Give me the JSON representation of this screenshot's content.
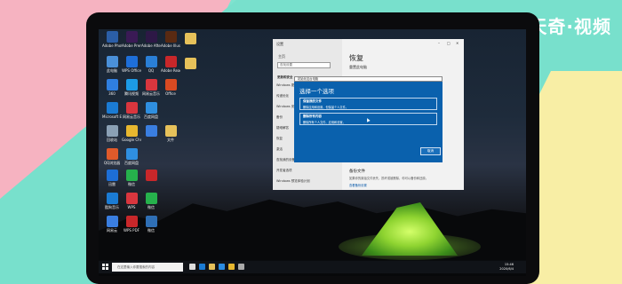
{
  "watermark": "天奇·视频",
  "settings": {
    "window_title": "设置",
    "home_label": "主页",
    "search_placeholder": "查找设置",
    "section_label": "更新和安全",
    "nav_items": [
      "Windows 更新",
      "传递优化",
      "Windows 安全中心",
      "备份",
      "疑难解答",
      "恢复",
      "激活",
      "查找我的设备",
      "开发者选项",
      "Windows 预览体验计划"
    ],
    "page_title": "恢复",
    "page_subtitle": "重置此电脑",
    "backup_heading": "备份文件",
    "backup_line": "如果你的原始文件丢失、损坏或被删除，你可以备份和还原。",
    "backup_link": "查看备份设置"
  },
  "dialog": {
    "bar_title": "初始化这台电脑",
    "title": "选择一个选项",
    "options": [
      {
        "title": "保留我的文件",
        "desc": "删除应用和设置，但保留个人文件。"
      },
      {
        "title": "删除所有内容",
        "desc": "删除所有个人文件、应用和设置。"
      }
    ],
    "cancel_label": "取消"
  },
  "taskbar": {
    "search_placeholder": "在这里输入你要搜索的内容",
    "time": "15:46",
    "date": "2020/6/4"
  },
  "desktop_icons": [
    "Adobe Photoshop",
    "Adobe Premiere",
    "Adobe After Effects",
    "Adobe Illustrator",
    "",
    "此电脑",
    "WPS Office",
    "QQ",
    "Adobe Reader",
    "",
    "360",
    "腾讯视频",
    "网易云音乐",
    "Office",
    "",
    "Microsoft Edge",
    "网易云音乐",
    "百度网盘",
    "",
    "回收站",
    "Google Chrome",
    "",
    "文件",
    "QQ浏览器",
    "百度网盘",
    "",
    "迅雷",
    "微信",
    "",
    "酷狗音乐",
    "WPS",
    "微信",
    "网易云",
    "WPS PDF",
    "微信"
  ]
}
